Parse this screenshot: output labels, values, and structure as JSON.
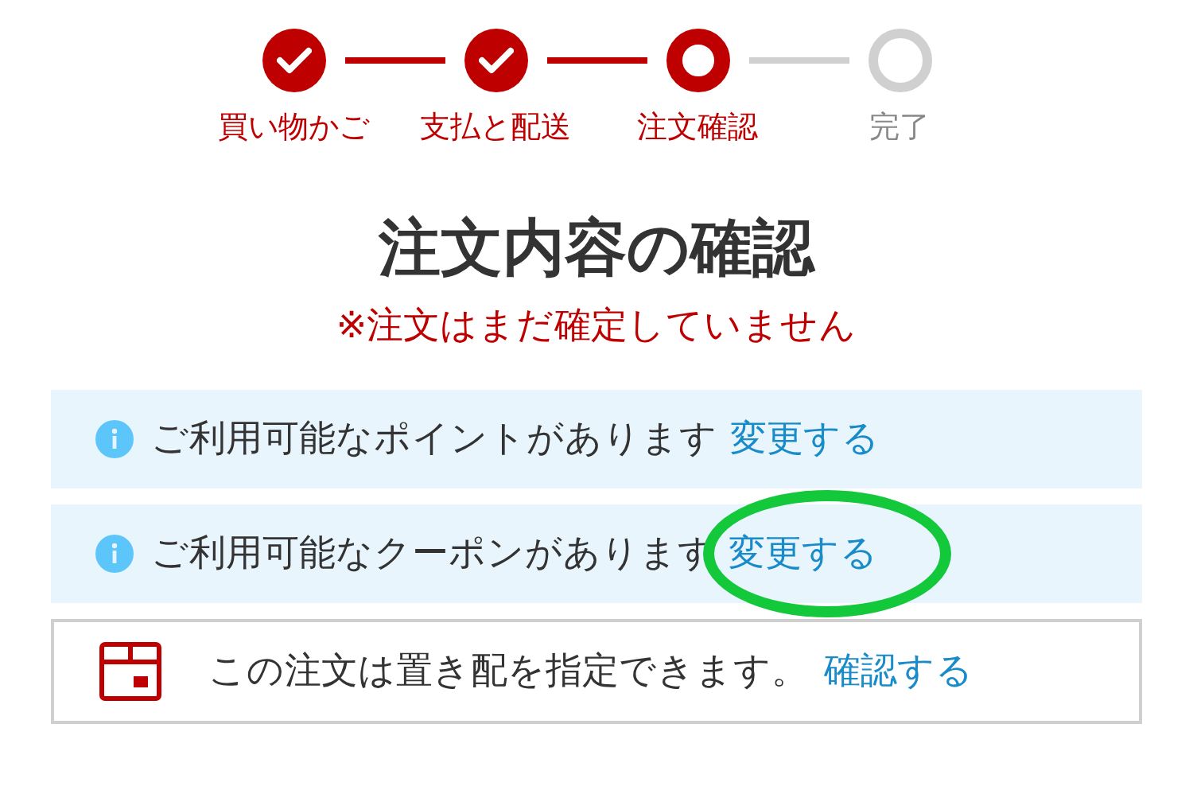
{
  "steps": [
    {
      "label": "買い物かご",
      "kind": "done"
    },
    {
      "label": "支払と配送",
      "kind": "done"
    },
    {
      "label": "注文確認",
      "kind": "current"
    },
    {
      "label": "完了",
      "kind": "pending"
    }
  ],
  "title": "注文内容の確認",
  "notice": "※注文はまだ確定していません",
  "banners": [
    {
      "text": "ご利用可能なポイントがあります",
      "link": "変更する"
    },
    {
      "text": "ご利用可能なクーポンがあります",
      "link": "変更する"
    }
  ],
  "delivery": {
    "text": "この注文は置き配を指定できます。",
    "link": "確認する"
  }
}
